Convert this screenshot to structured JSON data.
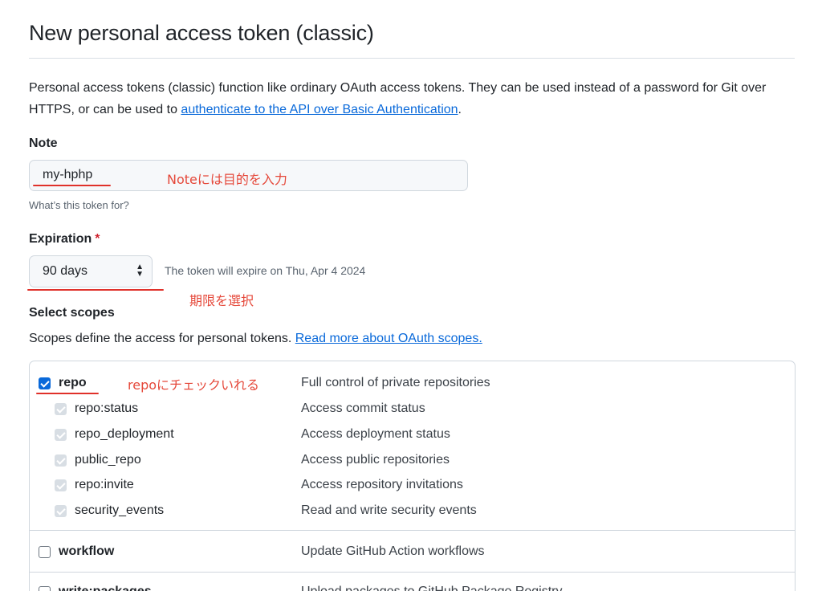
{
  "page": {
    "title": "New personal access token (classic)"
  },
  "intro": {
    "text": "Personal access tokens (classic) function like ordinary OAuth access tokens. They can be used instead of a password for Git over HTTPS, or can be used to ",
    "link": "authenticate to the API over Basic Authentication",
    "end": "."
  },
  "note": {
    "label": "Note",
    "value": "my-hphp",
    "hint": "What’s this token for?",
    "annotation": "Noteには目的を入力"
  },
  "expiration": {
    "label": "Expiration",
    "required_mark": "*",
    "selected": "90 days",
    "chevron": "▲▼",
    "note": "The token will expire on Thu, Apr 4 2024",
    "annotation": "期限を選択"
  },
  "scopes": {
    "heading": "Select scopes",
    "description": "Scopes define the access for personal tokens. ",
    "link": "Read more about OAuth scopes.",
    "repo_annotation": "repoにチェックいれる",
    "items": [
      {
        "name": "repo",
        "desc": "Full control of private repositories"
      },
      {
        "name": "repo:status",
        "desc": "Access commit status"
      },
      {
        "name": "repo_deployment",
        "desc": "Access deployment status"
      },
      {
        "name": "public_repo",
        "desc": "Access public repositories"
      },
      {
        "name": "repo:invite",
        "desc": "Access repository invitations"
      },
      {
        "name": "security_events",
        "desc": "Read and write security events"
      },
      {
        "name": "workflow",
        "desc": "Update GitHub Action workflows"
      },
      {
        "name": "write:packages",
        "desc": "Upload packages to GitHub Package Registry"
      }
    ]
  },
  "colors": {
    "link": "#0969da",
    "annotation": "#e5483a",
    "required": "#cf222e",
    "checkbox": "#0969da"
  }
}
